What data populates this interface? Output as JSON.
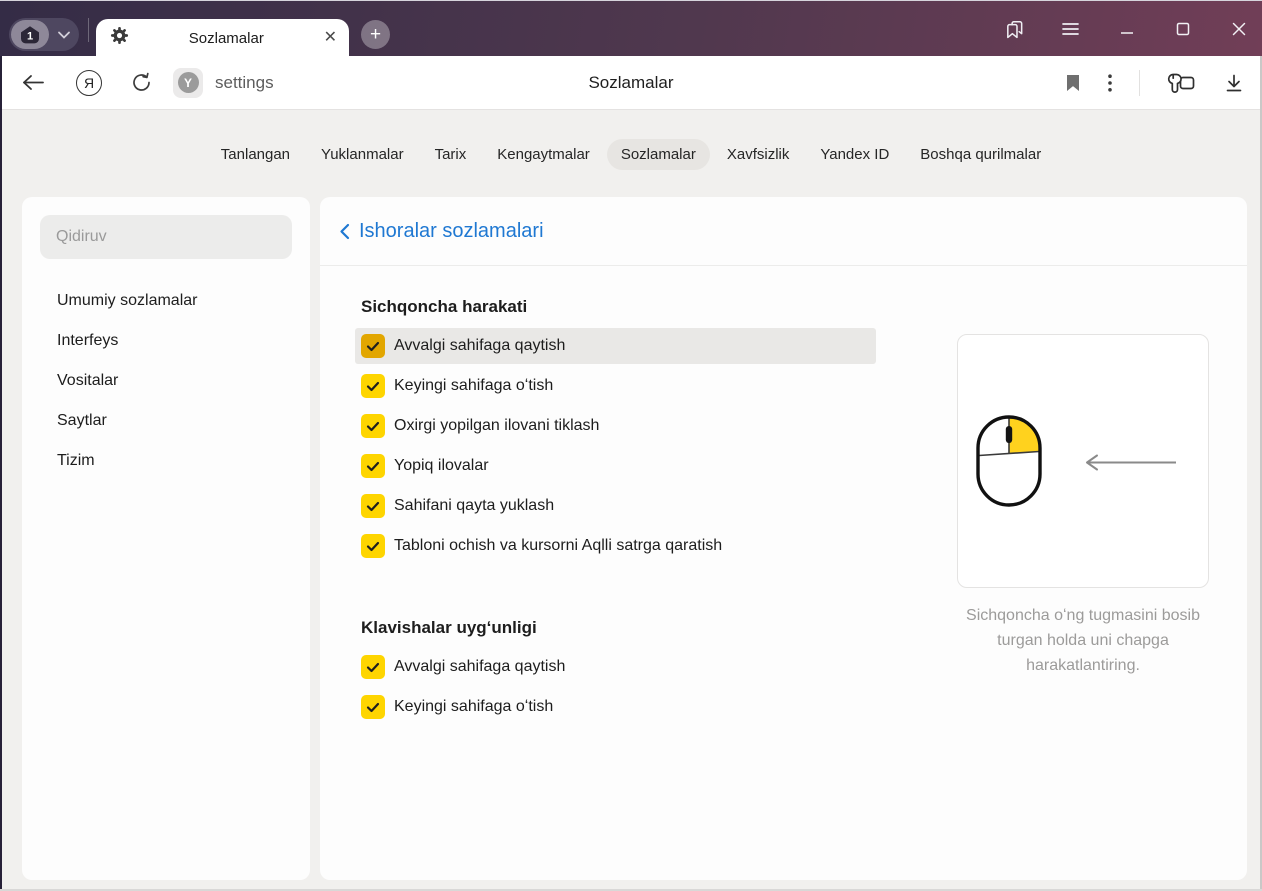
{
  "window": {
    "tab_count": "1",
    "tab_title": "Sozlamalar"
  },
  "toolbar": {
    "address_text": "settings",
    "page_title": "Sozlamalar"
  },
  "nav": {
    "items": [
      {
        "label": "Tanlangan",
        "active": false
      },
      {
        "label": "Yuklanmalar",
        "active": false
      },
      {
        "label": "Tarix",
        "active": false
      },
      {
        "label": "Kengaytmalar",
        "active": false
      },
      {
        "label": "Sozlamalar",
        "active": true
      },
      {
        "label": "Xavfsizlik",
        "active": false
      },
      {
        "label": "Yandex ID",
        "active": false
      },
      {
        "label": "Boshqa qurilmalar",
        "active": false
      }
    ]
  },
  "sidebar": {
    "search_placeholder": "Qidiruv",
    "items": [
      {
        "label": "Umumiy sozlamalar"
      },
      {
        "label": "Interfeys"
      },
      {
        "label": "Vositalar"
      },
      {
        "label": "Saytlar"
      },
      {
        "label": "Tizim"
      }
    ]
  },
  "main": {
    "back_title": "Ishoralar sozlamalari",
    "sections": [
      {
        "heading": "Sichqoncha harakati",
        "items": [
          {
            "label": "Avvalgi sahifaga qaytish",
            "checked": true,
            "highlighted": true
          },
          {
            "label": "Keyingi sahifaga oʻtish",
            "checked": true,
            "highlighted": false
          },
          {
            "label": "Oxirgi yopilgan ilovani tiklash",
            "checked": true,
            "highlighted": false
          },
          {
            "label": "Yopiq ilovalar",
            "checked": true,
            "highlighted": false
          },
          {
            "label": "Sahifani qayta yuklash",
            "checked": true,
            "highlighted": false
          },
          {
            "label": "Tabloni ochish va kursorni Aqlli satrga qaratish",
            "checked": true,
            "highlighted": false
          }
        ]
      },
      {
        "heading": "Klavishalar uygʻunligi",
        "items": [
          {
            "label": "Avvalgi sahifaga qaytish",
            "checked": true,
            "highlighted": false
          },
          {
            "label": "Keyingi sahifaga oʻtish",
            "checked": true,
            "highlighted": false
          }
        ]
      }
    ],
    "illustration": {
      "caption": "Sichqoncha oʻng tugmasini bosib turgan holda uni chapga harakatlantiring."
    }
  },
  "colors": {
    "checkbox_yellow": "#fed500",
    "checkbox_yellow_active": "#e2a600",
    "link_blue": "#1f78d2",
    "mouse_highlight_yellow": "#ffd21e",
    "titlebar_gradient_left": "#342c46",
    "titlebar_gradient_right": "#713e57"
  }
}
